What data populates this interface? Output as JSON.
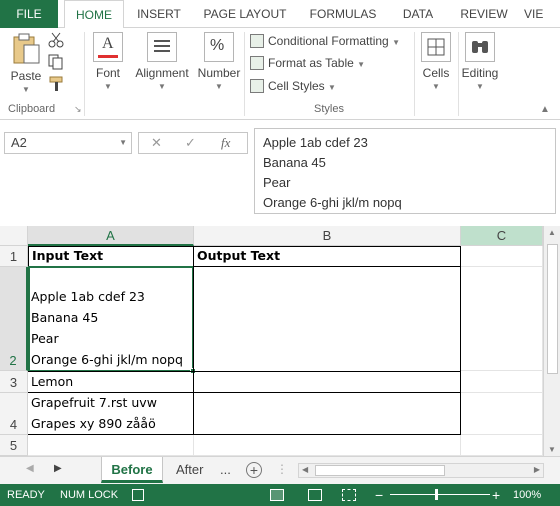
{
  "ribbon_tabs": [
    "FILE",
    "HOME",
    "INSERT",
    "PAGE LAYOUT",
    "FORMULAS",
    "DATA",
    "REVIEW",
    "VIE"
  ],
  "active_tab": "HOME",
  "clipboard": {
    "paste_label": "Paste",
    "group_label": "Clipboard"
  },
  "font": {
    "label": "Font"
  },
  "alignment": {
    "label": "Alignment"
  },
  "number": {
    "label": "Number",
    "glyph": "%"
  },
  "styles": {
    "conditional_formatting": "Conditional Formatting",
    "format_as_table": "Format as Table",
    "cell_styles": "Cell Styles",
    "group_label": "Styles"
  },
  "cells": {
    "label": "Cells"
  },
  "editing": {
    "label": "Editing"
  },
  "formula_bar": {
    "name_box": "A2",
    "fx": "fx",
    "content_lines": [
      "Apple 1ab cdef 23",
      "Banana 45",
      "Pear",
      "Orange 6-ghi jkl/m nopq"
    ]
  },
  "grid": {
    "columns": [
      "A",
      "B",
      "C"
    ],
    "rows": [
      "1",
      "2",
      "3",
      "4",
      "5"
    ],
    "header_row": {
      "a": "Input Text",
      "b": "Output Text"
    },
    "row2_lines": [
      "Apple 1ab cdef 23",
      "Banana 45",
      "Pear",
      "Orange 6-ghi jkl/m nopq"
    ],
    "row3": "Lemon",
    "row4_lines": [
      "Grapefruit 7.rst uvw",
      "Grapes xy 890 zååö"
    ]
  },
  "sheets": [
    "Before",
    "After"
  ],
  "sheet_more": "...",
  "active_sheet": "Before",
  "status": {
    "ready": "READY",
    "numlock": "NUM LOCK",
    "zoom": "100%"
  },
  "colors": {
    "accent": "#217346",
    "selection_col": "#bfe0cc"
  }
}
